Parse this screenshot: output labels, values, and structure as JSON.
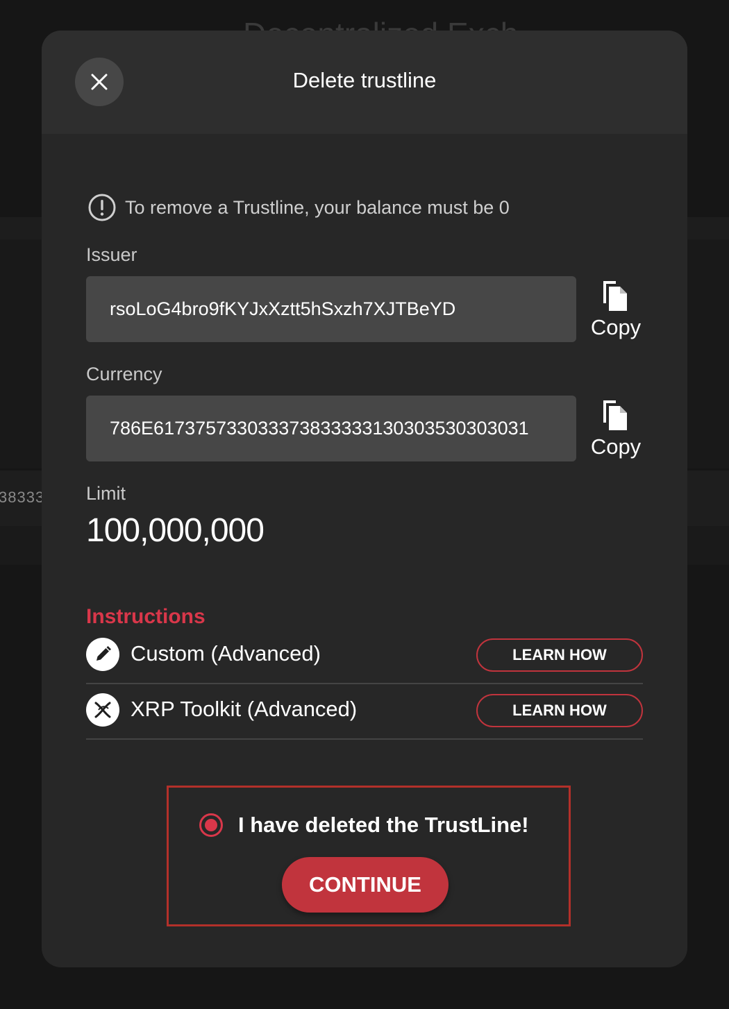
{
  "background": {
    "title_fragment": "Decentralized Exch",
    "table_cell_text": "38333"
  },
  "modal": {
    "title": "Delete trustline",
    "close_icon": "close-icon",
    "warning": {
      "icon": "exclamation-circle-icon",
      "text": "To remove a Trustline, your balance must be 0"
    },
    "issuer": {
      "label": "Issuer",
      "value": "rsoLoG4bro9fKYJxXztt5hSxzh7XJTBeYD",
      "copy_label": "Copy",
      "copy_icon": "copy-icon"
    },
    "currency": {
      "label": "Currency",
      "value": "786E617375733033373833333130303530303031",
      "copy_label": "Copy",
      "copy_icon": "copy-icon"
    },
    "limit": {
      "label": "Limit",
      "value": "100,000,000"
    },
    "instructions": {
      "heading": "Instructions",
      "items": [
        {
          "label": "Custom (Advanced)",
          "icon": "pencil-icon",
          "button": "LEARN HOW"
        },
        {
          "label": "XRP Toolkit (Advanced)",
          "icon": "xrp-toolkit-logo-icon",
          "button": "LEARN HOW"
        }
      ]
    },
    "confirmation": {
      "text": "I have deleted the TrustLine!",
      "selected": true,
      "continue_label": "CONTINUE"
    }
  },
  "colors": {
    "accent_red": "#c1343d",
    "instructions_red": "#d9374a",
    "confirm_border": "#b3302a",
    "modal_bg": "#272727",
    "field_bg": "#474747"
  }
}
